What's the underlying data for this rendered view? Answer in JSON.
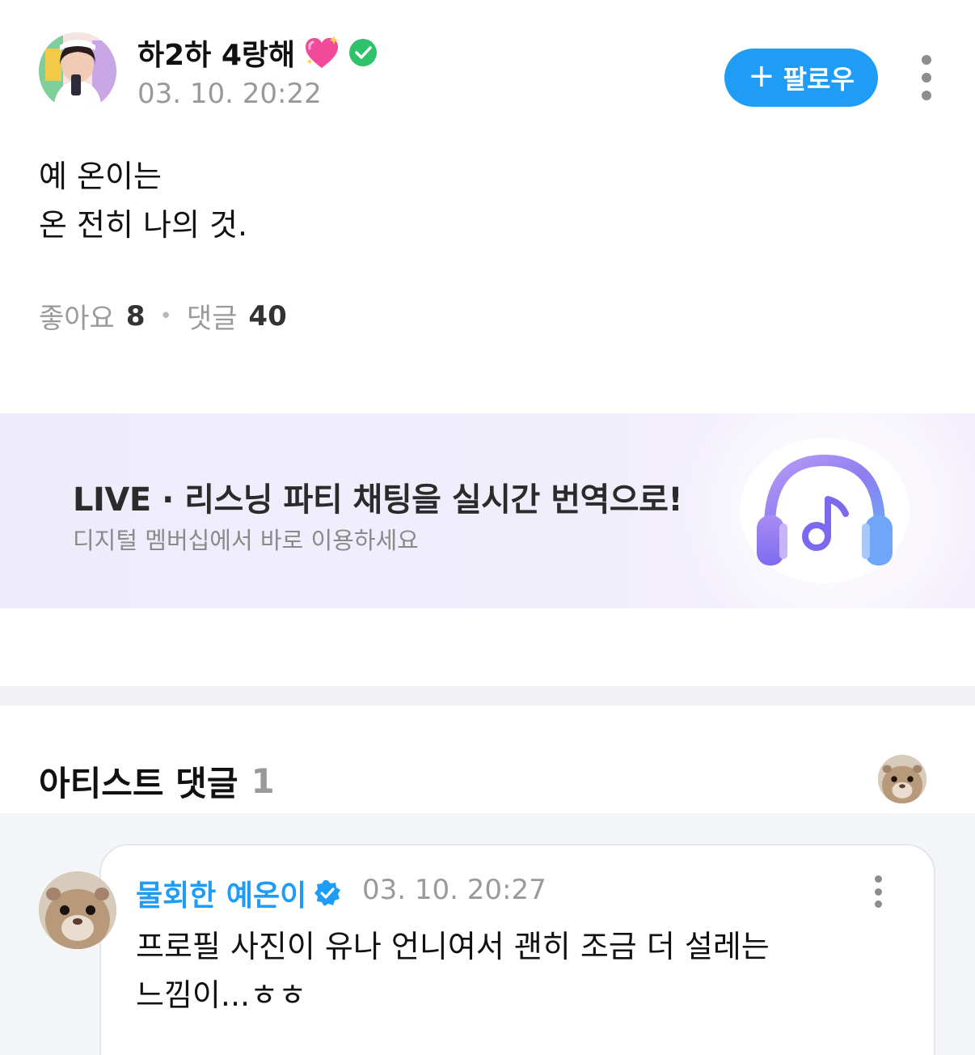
{
  "post": {
    "author_name": "하2하 4랑해",
    "author_badges": [
      "sparkling-heart-icon",
      "check-badge-icon"
    ],
    "timestamp": "03. 10. 20:22",
    "follow_label": "팔로우",
    "body_lines": [
      "예 온이는",
      "온 전히 나의 것."
    ],
    "likes_label": "좋아요",
    "likes_count": "8",
    "comments_label": "댓글",
    "comments_count": "40"
  },
  "banner": {
    "title": "LIVE · 리스닝 파티 채팅을 실시간 번역으로!",
    "subtitle": "디지털 멤버십에서 바로 이용하세요",
    "icon": "headphones-music-icon"
  },
  "artist_comments": {
    "title": "아티스트 댓글",
    "count": "1",
    "items": [
      {
        "author": "물회한 예온이",
        "verified": true,
        "timestamp": "03. 10. 20:27",
        "text_lines": [
          "프로필 사진이 유나 언니여서 괜히 조금 더 설레는",
          "느낌이...ㅎㅎ"
        ]
      }
    ]
  },
  "colors": {
    "accent": "#1f9cf5",
    "muted_text": "#9a9a9a",
    "banner_bg": "#efedfb",
    "divider": "#f2f2f4"
  }
}
